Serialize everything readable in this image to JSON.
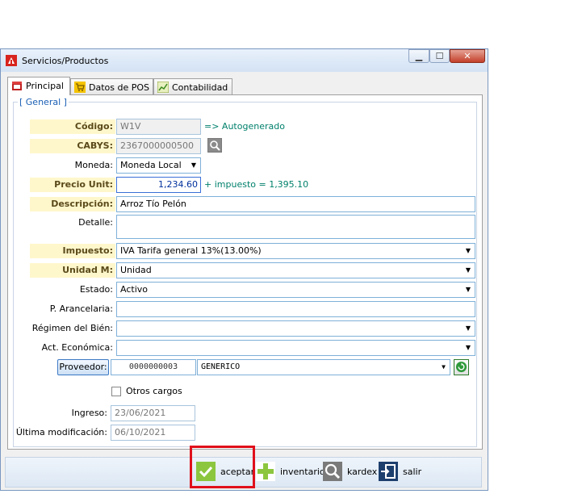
{
  "window": {
    "title": "Servicios/Productos",
    "controls": {
      "minimize": "▁",
      "maximize": "☐",
      "close": "✕"
    }
  },
  "tabs": [
    {
      "label": "Principal",
      "icon": "store-icon"
    },
    {
      "label": "Datos de POS",
      "icon": "cart-icon"
    },
    {
      "label": "Contabilidad",
      "icon": "chart-icon"
    }
  ],
  "group": {
    "label": "[ General ]"
  },
  "form": {
    "codigo": {
      "label": "Código:",
      "value": "W1V",
      "note": "=> Autogenerado"
    },
    "cabys": {
      "label": "CABYS:",
      "value": "2367000000500"
    },
    "moneda": {
      "label": "Moneda:",
      "value": "Moneda Local"
    },
    "precio": {
      "label": "Precio Unit:",
      "value": "1,234.60",
      "note": "+ impuesto = 1,395.10"
    },
    "descripcion": {
      "label": "Descripción:",
      "value": "Arroz Tío Pelón"
    },
    "detalle": {
      "label": "Detalle:",
      "value": ""
    },
    "impuesto": {
      "label": "Impuesto:",
      "value": "IVA Tarifa general 13%(13.00%)"
    },
    "unidad": {
      "label": "Unidad M:",
      "value": "Unidad"
    },
    "estado": {
      "label": "Estado:",
      "value": "Activo"
    },
    "arancelaria": {
      "label": "P. Arancelaria:",
      "value": ""
    },
    "regimen": {
      "label": "Régimen del Bién:",
      "value": ""
    },
    "actividad": {
      "label": "Act. Económica:",
      "value": ""
    },
    "proveedor": {
      "button": "Proveedor:",
      "code": "0000000003",
      "name": "GENERICO"
    },
    "otros_cargos": {
      "label": "Otros cargos",
      "checked": false
    },
    "ingreso": {
      "label": "Ingreso:",
      "value": "23/06/2021"
    },
    "modificacion": {
      "label": "Última modificación:",
      "value": "06/10/2021"
    }
  },
  "actions": {
    "aceptar": "aceptar",
    "inventario": "inventario",
    "kardex": "kardex",
    "salir": "salir"
  },
  "colors": {
    "accent": "#1a5fb4",
    "highlight": "#e0101a",
    "label_bg": "#fff7cc"
  }
}
